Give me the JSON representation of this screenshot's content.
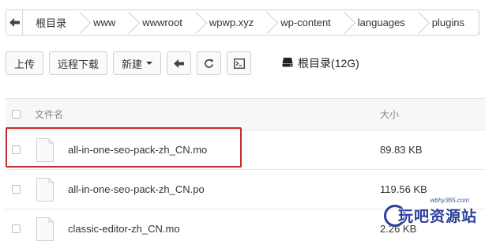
{
  "breadcrumb": {
    "items": [
      "根目录",
      "www",
      "wwwroot",
      "wpwp.xyz",
      "wp-content",
      "languages",
      "plugins"
    ]
  },
  "toolbar": {
    "upload_label": "上传",
    "remote_download_label": "远程下载",
    "new_label": "新建",
    "disk_label": "根目录(12G)"
  },
  "table": {
    "headers": {
      "name": "文件名",
      "size": "大小"
    },
    "rows": [
      {
        "name": "all-in-one-seo-pack-zh_CN.mo",
        "size": "89.83 KB",
        "highlighted": true
      },
      {
        "name": "all-in-one-seo-pack-zh_CN.po",
        "size": "119.56 KB",
        "highlighted": false
      },
      {
        "name": "classic-editor-zh_CN.mo",
        "size": "2.26 KB",
        "highlighted": false
      }
    ]
  },
  "watermark": {
    "url": "wbhy365.com",
    "text": "玩吧资源站"
  },
  "colors": {
    "highlight": "#c22f2f",
    "watermark": "#2c3e99"
  },
  "icons": [
    "back-arrow-icon",
    "refresh-icon",
    "terminal-icon",
    "disk-icon",
    "file-icon"
  ]
}
